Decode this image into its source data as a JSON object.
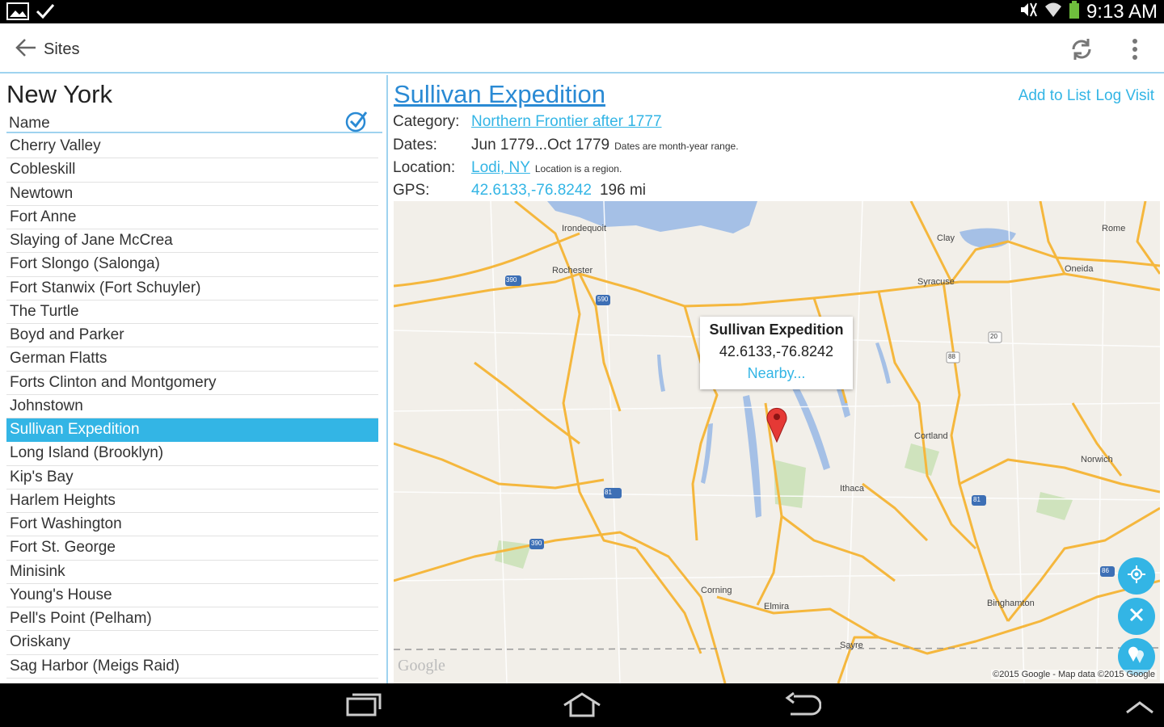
{
  "status_bar": {
    "time": "9:13 AM"
  },
  "action_bar": {
    "title": "Sites"
  },
  "left_pane": {
    "region_title": "New York",
    "column_header": "Name",
    "sites": [
      "Cherry Valley",
      "Cobleskill",
      "Newtown",
      "Fort Anne",
      "Slaying of Jane McCrea",
      "Fort Slongo (Salonga)",
      "Fort Stanwix (Fort Schuyler)",
      "The Turtle",
      "Boyd and Parker",
      "German Flatts",
      "Forts Clinton and Montgomery",
      "Johnstown",
      "Sullivan Expedition",
      "Long Island (Brooklyn)",
      "Kip's Bay",
      "Harlem Heights",
      "Fort Washington",
      "Fort St. George",
      "Minisink",
      "Young's House",
      "Pell's Point (Pelham)",
      "Oriskany",
      "Sag Harbor (Meigs Raid)"
    ],
    "selected_site": "Sullivan Expedition"
  },
  "detail": {
    "title": "Sullivan Expedition",
    "add_to_list": "Add to List",
    "log_visit": "Log Visit",
    "category_label": "Category:",
    "category_value": "Northern Frontier after 1777",
    "dates_label": "Dates:",
    "dates_value": "Jun 1779...Oct 1779",
    "dates_note": "Dates are month-year range.",
    "location_label": "Location:",
    "location_value": "Lodi, NY",
    "location_note": "Location is a region.",
    "gps_label": "GPS:",
    "gps_value": "42.6133,-76.8242",
    "distance": "196 mi"
  },
  "map": {
    "info_title": "Sullivan Expedition",
    "info_coords": "42.6133,-76.8242",
    "info_link": "Nearby...",
    "places": [
      "Irondequoit",
      "Rochester",
      "Clay",
      "Rome",
      "Oneida",
      "Syracuse",
      "Cortland",
      "Norwich",
      "Ithaca",
      "Corning",
      "Elmira",
      "Binghamton",
      "Sayre"
    ],
    "shields": [
      "390",
      "590",
      "81",
      "81",
      "390",
      "86",
      "88",
      "20"
    ],
    "logo": "Google",
    "attribution": "©2015 Google - Map data ©2015 Google"
  },
  "colors": {
    "accent": "#33b5e5",
    "link": "#2a8ad4",
    "road": "#f5b73d",
    "water": "#a5c0e6"
  }
}
